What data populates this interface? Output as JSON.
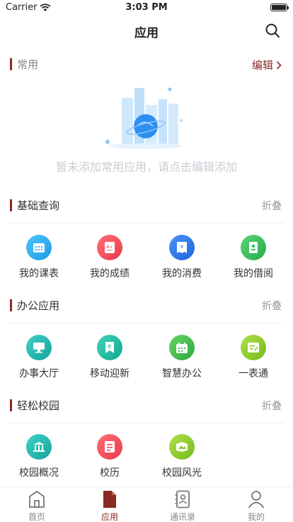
{
  "status_bar": {
    "carrier": "Carrier",
    "time": "3:03 PM"
  },
  "header": {
    "title": "应用"
  },
  "favorites": {
    "title": "常用",
    "edit_label": "编辑",
    "empty_text": "暂未添加常用应用，请点击编辑添加"
  },
  "sections": [
    {
      "title": "基础查询",
      "action": "折叠",
      "items": [
        {
          "label": "我的课表",
          "icon": "timetable-icon",
          "color": "#2bb0f0"
        },
        {
          "label": "我的成绩",
          "icon": "grade-icon",
          "color": "#f04a55"
        },
        {
          "label": "我的消费",
          "icon": "consumption-icon",
          "color": "#2d7cf0"
        },
        {
          "label": "我的借阅",
          "icon": "borrow-icon",
          "color": "#35c05a"
        }
      ]
    },
    {
      "title": "办公应用",
      "action": "折叠",
      "items": [
        {
          "label": "办事大厅",
          "icon": "service-hall-icon",
          "color": "#1fb5ac"
        },
        {
          "label": "移动迎新",
          "icon": "welcome-new-icon",
          "color": "#1fb8a0"
        },
        {
          "label": "智慧办公",
          "icon": "smart-office-icon",
          "color": "#3fc04a"
        },
        {
          "label": "一表通",
          "icon": "form-icon",
          "color": "#8ccc2a"
        }
      ]
    },
    {
      "title": "轻松校园",
      "action": "折叠",
      "items": [
        {
          "label": "校园概况",
          "icon": "campus-overview-icon",
          "color": "#1fb5ac"
        },
        {
          "label": "校历",
          "icon": "calendar-icon",
          "color": "#f04a55"
        },
        {
          "label": "校园风光",
          "icon": "scenery-icon",
          "color": "#8ccc2a"
        }
      ]
    }
  ],
  "tab_bar": {
    "items": [
      {
        "label": "首页",
        "icon": "home-icon"
      },
      {
        "label": "应用",
        "icon": "apps-icon"
      },
      {
        "label": "通讯录",
        "icon": "contacts-icon"
      },
      {
        "label": "我的",
        "icon": "profile-icon"
      }
    ],
    "active": "应用"
  },
  "colors": {
    "accent": "#8a2a22",
    "muted": "#999999"
  }
}
